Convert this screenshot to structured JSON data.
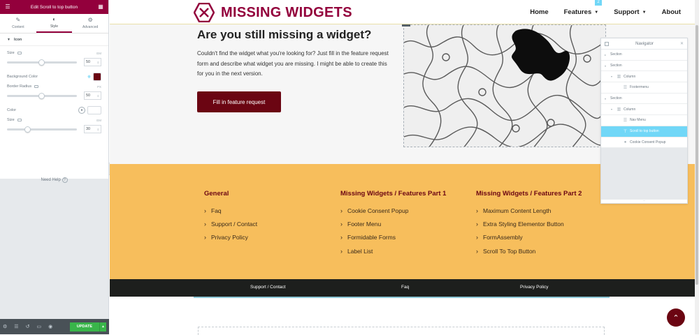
{
  "editor": {
    "title": "Edit Scroll to top button",
    "tabs": [
      {
        "label": "Content"
      },
      {
        "label": "Style"
      },
      {
        "label": "Advanced"
      }
    ],
    "section": "Icon",
    "controls": {
      "size1_label": "Size",
      "size1_unit": "EM",
      "size1_value": "50",
      "bg_label": "Background Color",
      "bg_color": "#6b0512",
      "radius_label": "Border Radius",
      "radius_unit": "PX",
      "radius_value": "50",
      "color_label": "Color",
      "size2_label": "Size",
      "size2_unit": "EM",
      "size2_value": "30"
    },
    "need_help": "Need Help",
    "update_label": "UPDATE"
  },
  "site": {
    "logo_text": "MISSING WIDGETS",
    "nav": [
      {
        "label": "Home",
        "dropdown": false
      },
      {
        "label": "Features",
        "dropdown": true
      },
      {
        "label": "Support",
        "dropdown": true
      },
      {
        "label": "About",
        "dropdown": false
      }
    ],
    "hero": {
      "title": "Are you still missing a widget?",
      "text": "Couldn't find the widget what you're looking for? Just fill in the feature request form and describe what widget you are missing. I might be able to create this for you in the next version.",
      "button": "Fill in feature request"
    },
    "footer_columns": [
      {
        "title": "General",
        "links": [
          "Faq",
          "Support / Contact",
          "Privacy Policy"
        ]
      },
      {
        "title": "Missing Widgets / Features Part 1",
        "links": [
          "Cookie Consent Popup",
          "Footer Menu",
          "Formidable Forms",
          "Label List"
        ]
      },
      {
        "title": "Missing Widgets / Features Part 2",
        "links": [
          "Maximum Content Length",
          "Extra Styling Elementor Button",
          "FormAssembly",
          "Scroll To Top Button"
        ]
      }
    ],
    "bottom_links": [
      "Support / Contact",
      "Faq",
      "Privacy Policy"
    ],
    "selection_badge": "2"
  },
  "navigator": {
    "title": "Navigator",
    "rows": [
      {
        "label": "Section",
        "level": 0,
        "icon": "none",
        "expanded": false,
        "selected": false
      },
      {
        "label": "Section",
        "level": 0,
        "icon": "none",
        "expanded": true,
        "selected": false
      },
      {
        "label": "Column",
        "level": 1,
        "icon": "column-icon",
        "expanded": true,
        "selected": false
      },
      {
        "label": "Footermenu",
        "level": 2,
        "icon": "menu-icon",
        "expanded": false,
        "selected": false
      },
      {
        "label": "Section",
        "level": 0,
        "icon": "none",
        "expanded": true,
        "selected": false
      },
      {
        "label": "Column",
        "level": 1,
        "icon": "column-icon",
        "expanded": true,
        "selected": false
      },
      {
        "label": "Nav Menu",
        "level": 2,
        "icon": "menu-icon",
        "expanded": false,
        "selected": false
      },
      {
        "label": "Scroll to top button",
        "level": 2,
        "icon": "scroll-icon",
        "expanded": false,
        "selected": true
      },
      {
        "label": "Cookie Consent Popup",
        "level": 2,
        "icon": "cookie-icon",
        "expanded": false,
        "selected": false
      }
    ]
  }
}
